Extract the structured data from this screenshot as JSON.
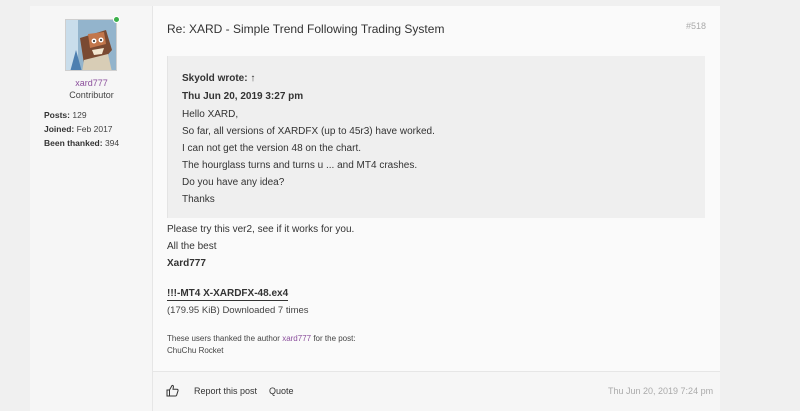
{
  "author": {
    "username": "xard777",
    "rank": "Contributor",
    "stats": [
      {
        "label": "Posts:",
        "value": "129"
      },
      {
        "label": "Joined:",
        "value": "Feb 2017"
      },
      {
        "label": "Been thanked:",
        "value": "394"
      }
    ],
    "status_color": "#3cb04a"
  },
  "post": {
    "title": "Re: XARD - Simple Trend Following Trading System",
    "number": "#518",
    "quote": {
      "header": "Skyold wrote: ↑",
      "date": "Thu Jun 20, 2019 3:27 pm",
      "lines": [
        "Hello XARD,",
        "So far, all versions of XARDFX (up to 45r3) have worked.",
        "I can not get the version 48 on the chart.",
        "The hourglass turns and turns u ... and MT4 crashes.",
        "Do you have any idea?",
        "Thanks"
      ]
    },
    "body": [
      "Please try this ver2, see if it works for you.",
      "All the best"
    ],
    "signature": "Xard777",
    "attachment": {
      "name": "!!!-MT4 X-XARDFX-48.ex4",
      "meta": "(179.95 KiB) Downloaded 7 times"
    },
    "thanks": {
      "prefix": "These users thanked the author ",
      "user": "xard777",
      "suffix": " for the post:",
      "names": "ChuChu Rocket"
    }
  },
  "footer": {
    "report_label": "Report this post",
    "quote_label": "Quote",
    "timestamp": "Thu Jun 20, 2019 7:24 pm"
  }
}
